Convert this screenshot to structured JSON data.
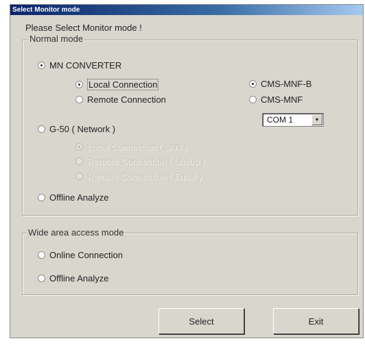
{
  "window": {
    "title": "Select Monitor mode"
  },
  "prompt": "Please Select Monitor mode !",
  "normal_mode": {
    "legend": "Normal mode",
    "mn_converter": {
      "label": "MN CONVERTER",
      "checked": true
    },
    "local_connection": {
      "label": "Local Connection",
      "checked": true
    },
    "remote_connection": {
      "label": "Remote Connection",
      "checked": false
    },
    "cms_mnf_b": {
      "label": "CMS-MNF-B",
      "checked": true
    },
    "cms_mnf": {
      "label": "CMS-MNF",
      "checked": false
    },
    "com_port": {
      "value": "COM 1"
    },
    "g50_network": {
      "label": "G-50 ( Network )",
      "checked": false
    },
    "g50_option_1": {
      "label": "Local Connection ( LAN )",
      "checked": true,
      "disabled": true
    },
    "g50_option_2": {
      "label": "Remote Connection ( Dialup )",
      "checked": false,
      "disabled": true
    },
    "g50_option_3": {
      "label": "Remote Connection ( Email )",
      "checked": false,
      "disabled": true
    },
    "offline_analyze": {
      "label": "Offline Analyze",
      "checked": false
    }
  },
  "wide_area_mode": {
    "legend": "Wide area access mode",
    "online_connection": {
      "label": "Online Connection",
      "checked": false
    },
    "offline_analyze": {
      "label": "Offline Analyze",
      "checked": false
    }
  },
  "buttons": {
    "select": "Select",
    "exit": "Exit"
  }
}
